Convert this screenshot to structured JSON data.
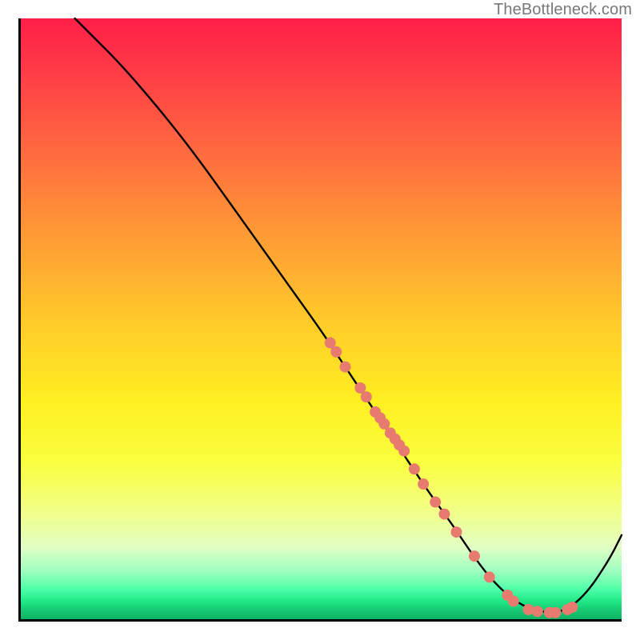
{
  "watermark": "TheBottleneck.com",
  "chart_data": {
    "type": "line",
    "title": "",
    "xlabel": "",
    "ylabel": "",
    "xlim": [
      0,
      100
    ],
    "ylim": [
      0,
      100
    ],
    "grid": false,
    "curve": {
      "x": [
        9,
        12,
        16,
        20,
        25,
        30,
        35,
        40,
        45,
        50,
        53,
        56,
        59,
        62,
        65,
        68,
        72,
        75,
        78,
        81,
        83.5,
        86,
        90,
        94,
        98,
        100
      ],
      "y": [
        100,
        97,
        93,
        88.5,
        82.5,
        76,
        69,
        62,
        55,
        48,
        43.5,
        39,
        34.5,
        30,
        25.5,
        21,
        15.5,
        11,
        7,
        4,
        2.3,
        1.3,
        1,
        4,
        10,
        14
      ]
    },
    "series": [
      {
        "name": "markers-on-curve",
        "marker_color": "#e87b6f",
        "points_x": [
          51.5,
          52.5,
          54,
          56.5,
          57.5,
          59,
          59.8,
          60.5,
          61.5,
          62.3,
          63,
          63.8,
          65.5,
          67,
          69,
          70.5,
          72.5,
          75.5,
          78,
          81,
          82,
          84.5,
          86,
          88,
          89,
          91,
          91.8
        ],
        "points_y": [
          46,
          44.5,
          42,
          38.5,
          37,
          34.5,
          33.5,
          32.5,
          31,
          30,
          29,
          28,
          25,
          22.5,
          19.5,
          17.5,
          14.5,
          10.5,
          7,
          4,
          3,
          1.6,
          1.3,
          1.1,
          1.1,
          1.6,
          2.0
        ]
      }
    ]
  }
}
